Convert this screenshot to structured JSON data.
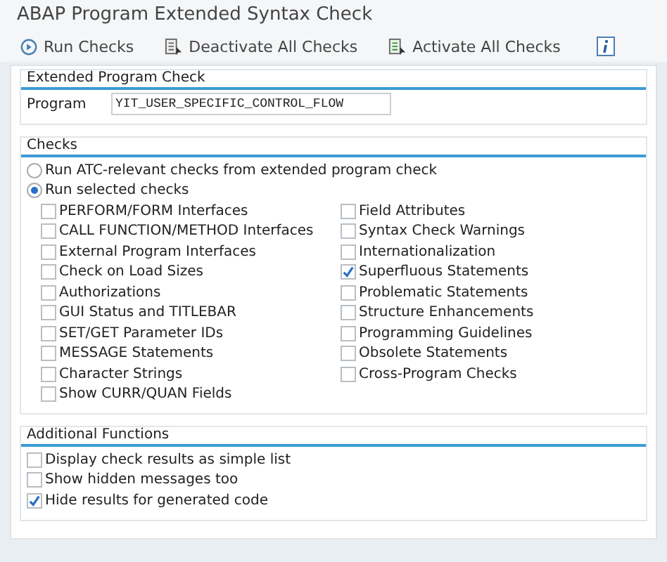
{
  "window": {
    "title": "ABAP Program Extended Syntax Check"
  },
  "toolbar": [
    {
      "label": "Run Checks",
      "kind": "run"
    },
    {
      "label": "Deactivate All Checks",
      "kind": "deactivate"
    },
    {
      "label": "Activate All Checks",
      "kind": "activate"
    },
    {
      "kind": "info"
    }
  ],
  "program_group": {
    "title": "Extended Program Check",
    "label": "Program",
    "value": "YIT_USER_SPECIFIC_CONTROL_FLOW"
  },
  "checks": {
    "title": "Checks",
    "modes": [
      {
        "label": "Run ATC-relevant checks from extended program check",
        "selected": false
      },
      {
        "label": "Run selected checks",
        "selected": true
      }
    ],
    "columns": [
      [
        {
          "label": "PERFORM/FORM Interfaces",
          "checked": false
        },
        {
          "label": "CALL FUNCTION/METHOD Interfaces",
          "checked": false
        },
        {
          "label": "External Program Interfaces",
          "checked": false
        },
        {
          "label": "Check on Load Sizes",
          "checked": false
        },
        {
          "label": "Authorizations",
          "checked": false
        },
        {
          "label": "GUI Status and TITLEBAR",
          "checked": false
        },
        {
          "label": "SET/GET Parameter IDs",
          "checked": false
        },
        {
          "label": "MESSAGE Statements",
          "checked": false
        },
        {
          "label": "Character Strings",
          "checked": false
        },
        {
          "label": "Show CURR/QUAN Fields",
          "checked": false
        }
      ],
      [
        {
          "label": "Field Attributes",
          "checked": false
        },
        {
          "label": "Syntax Check Warnings",
          "checked": false
        },
        {
          "label": "Internationalization",
          "checked": false
        },
        {
          "label": "Superfluous Statements",
          "checked": true
        },
        {
          "label": "Problematic Statements",
          "checked": false
        },
        {
          "label": "Structure Enhancements",
          "checked": false
        },
        {
          "label": "Programming Guidelines",
          "checked": false
        },
        {
          "label": "Obsolete Statements",
          "checked": false
        },
        {
          "label": "Cross-Program Checks",
          "checked": false
        }
      ]
    ]
  },
  "additional": {
    "title": "Additional Functions",
    "options": [
      {
        "label": "Display check results as simple list",
        "checked": false
      },
      {
        "label": "Show hidden messages too",
        "checked": false
      },
      {
        "label": "Hide results for generated code",
        "checked": true
      }
    ]
  }
}
